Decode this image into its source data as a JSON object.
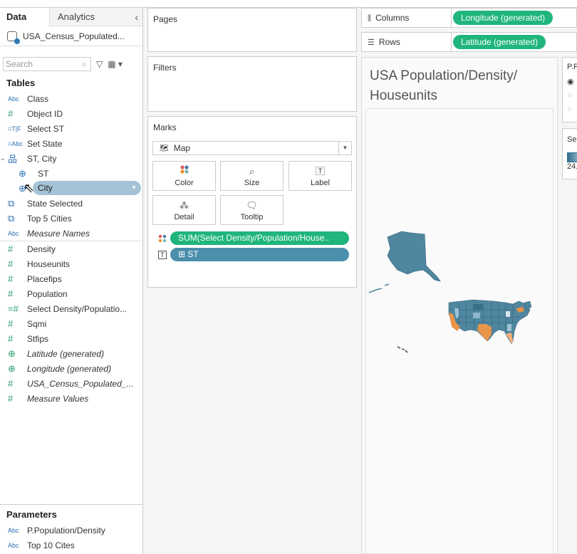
{
  "data_pane": {
    "tabs": [
      "Data",
      "Analytics"
    ],
    "datasource": "USA_Census_Populated...",
    "search_placeholder": "Search",
    "tables_heading": "Tables",
    "fields": [
      {
        "icon": "Abc",
        "label": "Class"
      },
      {
        "icon": "#",
        "label": "Object ID"
      },
      {
        "icon": "=T|F",
        "label": "Select ST"
      },
      {
        "icon": "=Abc",
        "label": "Set State"
      },
      {
        "icon": "hierarchy",
        "label": "ST, City"
      },
      {
        "icon": "globe",
        "label": "ST"
      },
      {
        "icon": "globe",
        "label": "City"
      },
      {
        "icon": "set",
        "label": "State Selected"
      },
      {
        "icon": "set",
        "label": "Top 5 Cities"
      },
      {
        "icon": "Abc",
        "label": "Measure Names"
      },
      {
        "icon": "#",
        "label": "Density"
      },
      {
        "icon": "#",
        "label": "Houseunits"
      },
      {
        "icon": "#",
        "label": "Placefips"
      },
      {
        "icon": "#",
        "label": "Population"
      },
      {
        "icon": "=#",
        "label": "Select Density/Populatio..."
      },
      {
        "icon": "#",
        "label": "Sqmi"
      },
      {
        "icon": "#",
        "label": "Stfips"
      },
      {
        "icon": "globe",
        "label": "Latitude (generated)"
      },
      {
        "icon": "globe",
        "label": "Longitude (generated)"
      },
      {
        "icon": "#",
        "label": "USA_Census_Populated_..."
      },
      {
        "icon": "#",
        "label": "Measure Values"
      }
    ],
    "parameters_heading": "Parameters",
    "parameters": [
      {
        "icon": "Abc",
        "label": "P.Population/Density"
      },
      {
        "icon": "Abc",
        "label": "Top 10 Cites"
      }
    ]
  },
  "cards": {
    "pages": "Pages",
    "filters": "Filters",
    "marks": "Marks",
    "mark_type": "Map",
    "buttons": [
      "Color",
      "Size",
      "Label",
      "Detail",
      "Tooltip"
    ],
    "pill_color": "SUM(Select Density/Population/House..",
    "pill_detail": "ST"
  },
  "shelves": {
    "columns_label": "Columns",
    "columns_pill": "Longitude (generated)",
    "rows_label": "Rows",
    "rows_pill": "Latitude (generated)"
  },
  "view": {
    "title": "USA Population/Density/ Houseunits"
  },
  "right": {
    "param_card_label": "P.F",
    "legend_card_label": "Se",
    "legend_value": "24."
  },
  "colors": {
    "green_pill": "#1fb57c",
    "blue_pill": "#4a8fab",
    "map_blue": "#4f86a0",
    "map_orange": "#e8954a"
  }
}
